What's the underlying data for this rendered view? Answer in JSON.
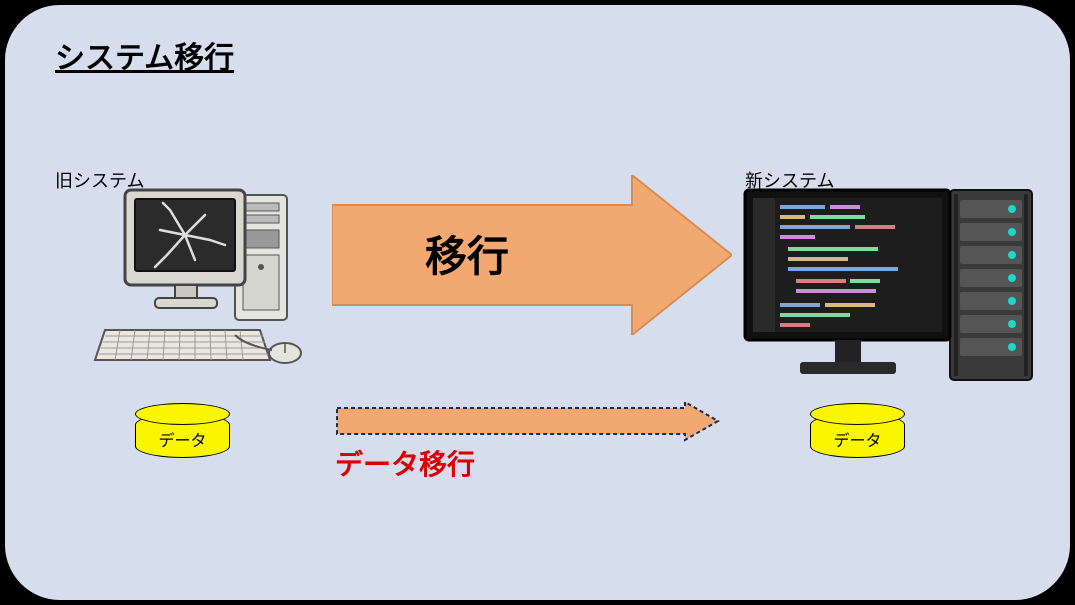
{
  "title": "システム移行",
  "old_system_label": "旧システム",
  "new_system_label": "新システム",
  "db_label": "データ",
  "migration_arrow_label": "移行",
  "data_migration_label": "データ移行",
  "colors": {
    "panel_bg": "#d6deee",
    "arrow_fill": "#f2a971",
    "db_fill": "#faf600",
    "data_migration_text": "#d90000"
  }
}
